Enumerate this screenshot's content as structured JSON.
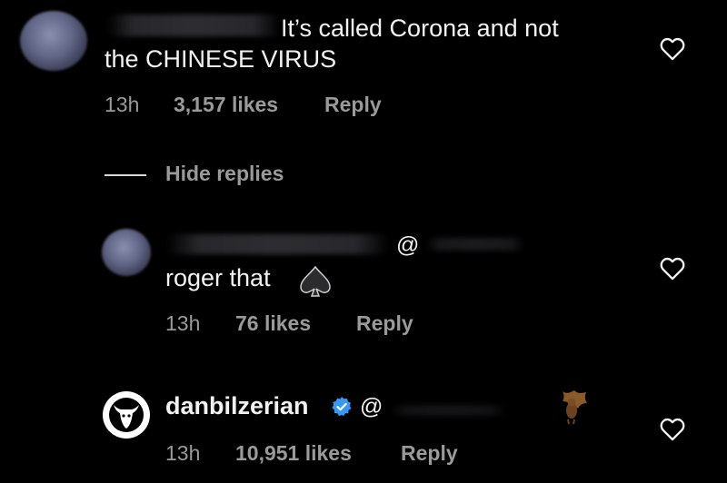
{
  "comment_main": {
    "text_line1": "It’s called Corona and not",
    "text_line2": "the CHINESE VIRUS",
    "time": "13h",
    "likes": "3,157 likes",
    "reply": "Reply"
  },
  "hide_replies": "Hide replies",
  "reply_1": {
    "mention_symbol": "@",
    "text": "roger that",
    "time": "13h",
    "likes": "76 likes",
    "reply": "Reply"
  },
  "reply_2": {
    "username": "danbilzerian",
    "mention_symbol": "@",
    "time": "13h",
    "likes": "10,951 likes",
    "reply": "Reply"
  },
  "colors": {
    "background": "#000000",
    "primary_text": "#f2f2f2",
    "secondary_text": "#9a9a9a",
    "verified_badge": "#3897f0"
  },
  "icons": [
    "heart-icon",
    "verified-badge-icon",
    "goat-logo-icon",
    "bat-emoji-icon",
    "spade-emoji-icon"
  ]
}
